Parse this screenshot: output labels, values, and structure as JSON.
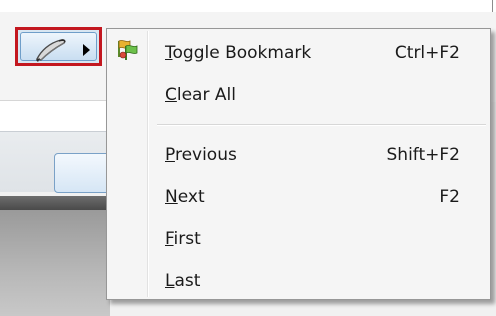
{
  "toolbar": {
    "bookmark_button": {
      "icon": "bookmark-pen-icon",
      "dropdown_icon": "triangle-right-icon",
      "highlight_color": "#c3171f"
    }
  },
  "menu": {
    "icon": "bookmark-flags-icon",
    "items": [
      {
        "mnemonic": "T",
        "rest": "oggle Bookmark",
        "shortcut": "Ctrl+F2"
      },
      {
        "mnemonic": "C",
        "rest": "lear All",
        "shortcut": ""
      },
      {
        "mnemonic": "P",
        "rest": "revious",
        "shortcut": "Shift+F2"
      },
      {
        "mnemonic": "N",
        "rest": "ext",
        "shortcut": "F2"
      },
      {
        "mnemonic": "F",
        "rest": "irst",
        "shortcut": ""
      },
      {
        "mnemonic": "L",
        "rest": "ast",
        "shortcut": ""
      }
    ]
  }
}
